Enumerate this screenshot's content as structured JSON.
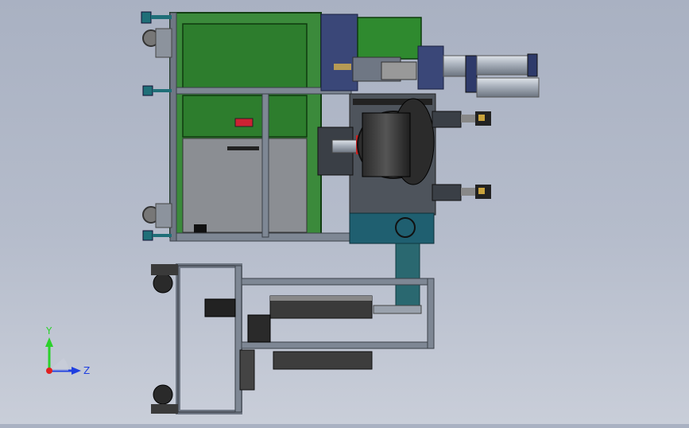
{
  "viewport": {
    "background_top": "#a9b1c2",
    "background_bottom": "#c9ced9"
  },
  "triad": {
    "y_label": "Y",
    "z_label": "Z",
    "y_color": "#2bd12b",
    "z_color": "#1f3fe0",
    "x_color": "#e02020"
  },
  "colors": {
    "frame_green": "#2a7a2a",
    "frame_green_dark": "#155515",
    "steel": "#6f7784",
    "steel_dark": "#3b4049",
    "teal": "#1f6f78",
    "navy": "#2e3a6a",
    "gray_panel": "#8c8f94",
    "black": "#1c1c1c",
    "light_steel": "#b8c0cc"
  }
}
